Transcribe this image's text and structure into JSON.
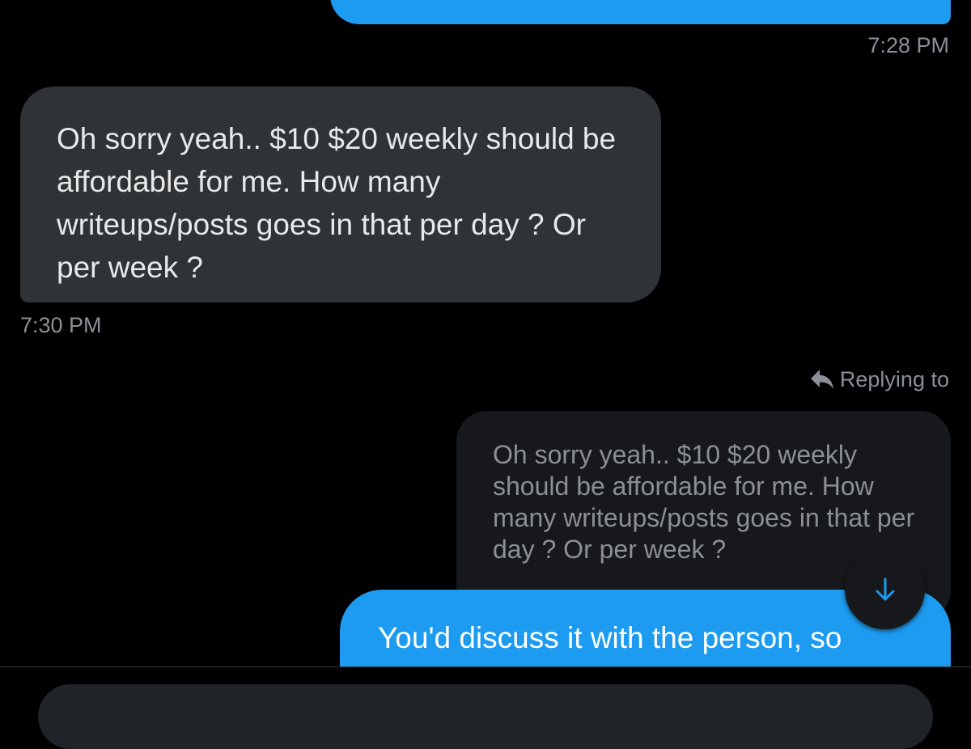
{
  "messages": {
    "received_text": "Oh sorry yeah.. $10 $20 weekly should be affordable for me. How many writeups/posts goes in that per day ? Or per week ?",
    "received_time": "7:30 PM",
    "previous_sent_time": "7:28 PM",
    "reply": {
      "label": "Replying to",
      "quoted_text": "Oh sorry yeah.. $10 $20 weekly should be affordable for me. How many writeups/posts goes in that per day ? Or per week ?",
      "sent_text": "You'd discuss it with the person, so"
    }
  },
  "icons": {
    "reply": "reply-arrow-icon",
    "scroll_down": "arrow-down-icon"
  },
  "colors": {
    "background": "#000000",
    "sent_bubble": "#1d9bf0",
    "received_bubble": "#2f3336",
    "quoted_bubble": "#16181c",
    "secondary_text": "#8b9096"
  }
}
